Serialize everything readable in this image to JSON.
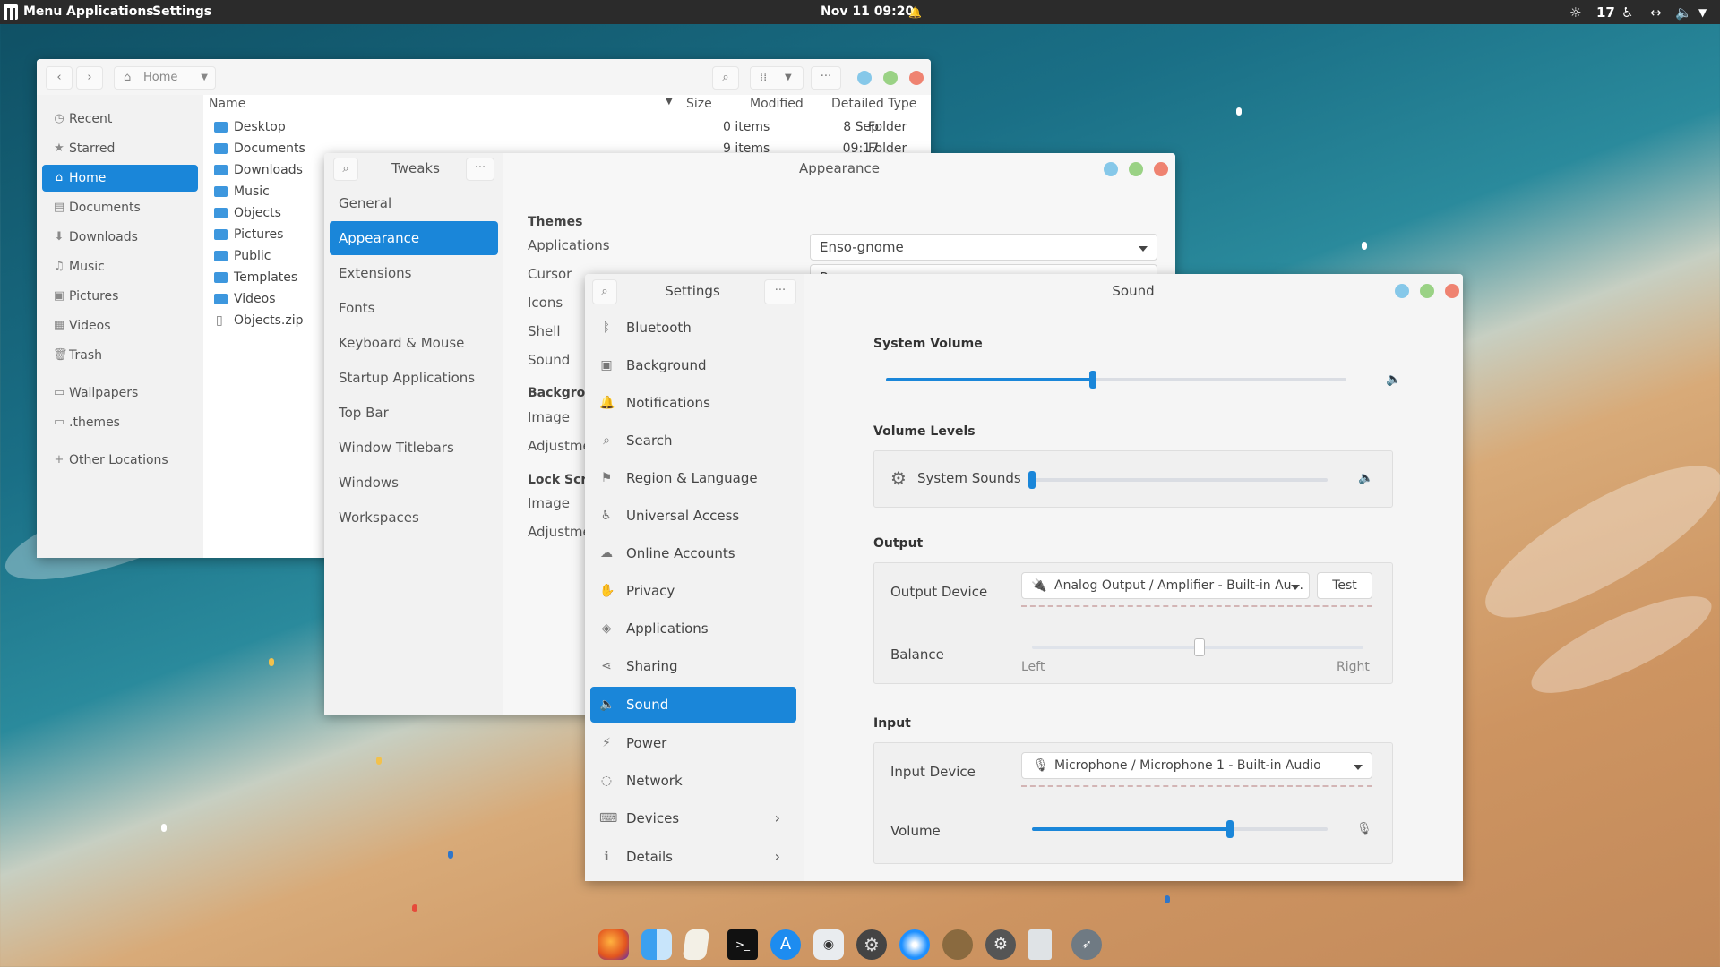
{
  "topbar": {
    "menu": "Menu",
    "applications": "Applications",
    "settings": "Settings",
    "clock": "Nov 11  09:20",
    "count": "17"
  },
  "files": {
    "location": "Home",
    "sidebar": [
      {
        "label": "Recent",
        "icon": "clock-icon"
      },
      {
        "label": "Starred",
        "icon": "star-icon"
      },
      {
        "label": "Home",
        "icon": "home-icon"
      },
      {
        "label": "Documents",
        "icon": "documents-icon"
      },
      {
        "label": "Downloads",
        "icon": "download-icon"
      },
      {
        "label": "Music",
        "icon": "music-icon"
      },
      {
        "label": "Pictures",
        "icon": "pictures-icon"
      },
      {
        "label": "Videos",
        "icon": "videos-icon"
      },
      {
        "label": "Trash",
        "icon": "trash-icon"
      },
      {
        "label": "Wallpapers",
        "icon": "folder-icon"
      },
      {
        "label": ".themes",
        "icon": "folder-icon"
      },
      {
        "label": "Other Locations",
        "icon": "plus-icon"
      }
    ],
    "columns": {
      "name": "Name",
      "size": "Size",
      "modified": "Modified",
      "type": "Detailed Type"
    },
    "rows": [
      {
        "name": "Desktop",
        "size": "0 items",
        "modified": "8 Sep",
        "type": "Folder"
      },
      {
        "name": "Documents",
        "size": "9 items",
        "modified": "09:17",
        "type": "Folder"
      },
      {
        "name": "Downloads"
      },
      {
        "name": "Music"
      },
      {
        "name": "Objects"
      },
      {
        "name": "Pictures"
      },
      {
        "name": "Public"
      },
      {
        "name": "Templates"
      },
      {
        "name": "Videos"
      },
      {
        "name": "Objects.zip"
      }
    ]
  },
  "tweaks": {
    "title": "Tweaks",
    "page_title": "Appearance",
    "sidebar": [
      "General",
      "Appearance",
      "Extensions",
      "Fonts",
      "Keyboard & Mouse",
      "Startup Applications",
      "Top Bar",
      "Window Titlebars",
      "Windows",
      "Workspaces"
    ],
    "themes_heading": "Themes",
    "labels": [
      "Applications",
      "Cursor",
      "Icons",
      "Shell",
      "Sound"
    ],
    "app_theme": "Enso-gnome",
    "cursor_theme": "Paper",
    "background_heading": "Backgrou",
    "background_labels": [
      "Image",
      "Adjustme"
    ],
    "lock_heading": "Lock Scre",
    "lock_labels": [
      "Image",
      "Adjustme"
    ]
  },
  "settings": {
    "title": "Settings",
    "page_title": "Sound",
    "sidebar": [
      {
        "label": "Bluetooth",
        "icon": "bluetooth-icon"
      },
      {
        "label": "Background",
        "icon": "background-icon"
      },
      {
        "label": "Notifications",
        "icon": "bell-icon"
      },
      {
        "label": "Search",
        "icon": "search-icon"
      },
      {
        "label": "Region & Language",
        "icon": "flag-icon"
      },
      {
        "label": "Universal Access",
        "icon": "accessibility-icon"
      },
      {
        "label": "Online Accounts",
        "icon": "cloud-icon"
      },
      {
        "label": "Privacy",
        "icon": "hand-icon"
      },
      {
        "label": "Applications",
        "icon": "applications-icon"
      },
      {
        "label": "Sharing",
        "icon": "share-icon"
      },
      {
        "label": "Sound",
        "icon": "speaker-icon"
      },
      {
        "label": "Power",
        "icon": "power-icon"
      },
      {
        "label": "Network",
        "icon": "network-icon"
      },
      {
        "label": "Devices",
        "icon": "devices-icon"
      },
      {
        "label": "Details",
        "icon": "details-icon"
      }
    ],
    "sound": {
      "system_volume_heading": "System Volume",
      "system_volume": 0.45,
      "volume_levels_heading": "Volume Levels",
      "system_sounds_label": "System Sounds",
      "system_sounds_level": 0.0,
      "output_heading": "Output",
      "output_device_label": "Output Device",
      "output_device": "Analog Output / Amplifier - Built-in Au...",
      "test_button": "Test",
      "balance_label": "Balance",
      "balance_left": "Left",
      "balance_right": "Right",
      "balance": 0.5,
      "input_heading": "Input",
      "input_device_label": "Input Device",
      "input_device": "Microphone / Microphone 1 - Built-in Audio",
      "volume_label": "Volume",
      "input_volume": 0.67
    }
  },
  "dock": [
    "firefox-icon",
    "finder-icon",
    "notes-icon",
    "terminal-icon",
    "app-store-icon",
    "screenshot-icon",
    "settings-gear-icon",
    "safari-icon",
    "gimp-icon",
    "system-preferences-icon",
    "trash-icon",
    "launcher-icon"
  ]
}
